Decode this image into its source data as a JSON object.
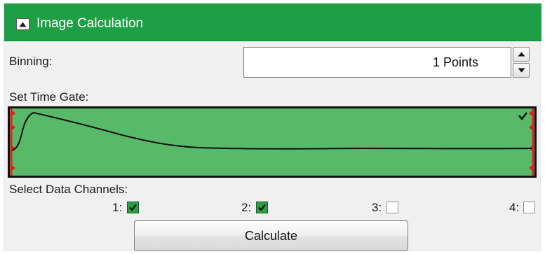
{
  "panel": {
    "title": "Image Calculation",
    "header_color": "#1e9f45"
  },
  "binning": {
    "label": "Binning:",
    "value": "1 Points"
  },
  "time_gate": {
    "label": "Set Time Gate:",
    "fill_color": "#58ba68",
    "gate_enabled": true
  },
  "channels": {
    "label": "Select Data Channels:",
    "items": [
      {
        "label": "1:",
        "checked": true
      },
      {
        "label": "2:",
        "checked": true
      },
      {
        "label": "3:",
        "checked": false
      },
      {
        "label": "4:",
        "checked": false
      }
    ]
  },
  "calculate_button": {
    "label": "Calculate"
  }
}
